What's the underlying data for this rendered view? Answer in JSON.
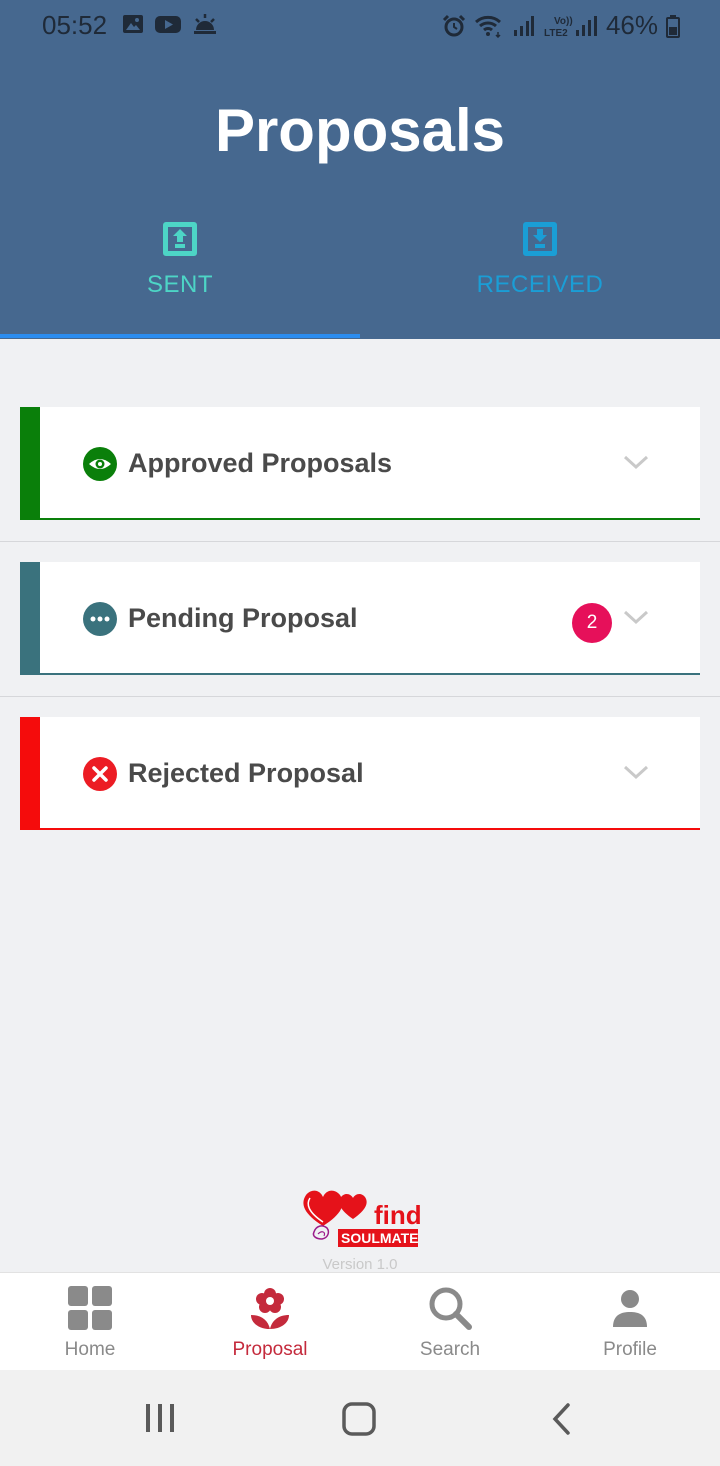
{
  "status_bar": {
    "time": "05:52",
    "battery": "46%",
    "left_icons": [
      "image-icon",
      "youtube-icon",
      "weather-icon"
    ],
    "right_icons": [
      "alarm-icon",
      "wifi-icon",
      "signal-icon",
      "volte-lte2-icon",
      "battery-icon"
    ]
  },
  "header": {
    "title": "Proposals",
    "tabs": [
      {
        "label": "SENT",
        "icon": "outbox-upload-icon",
        "color": "#4dd5c6",
        "selected": true
      },
      {
        "label": "RECEIVED",
        "icon": "inbox-download-icon",
        "color": "#1a9ed6",
        "selected": false
      }
    ],
    "background": "#46688f",
    "indicator_color": "#2b8df0"
  },
  "sections": [
    {
      "label": "Approved Proposals",
      "icon": "eye-icon",
      "accent": "#0a7f0a"
    },
    {
      "label": "Pending Proposal",
      "icon": "more-dots-icon",
      "accent": "#3a727d",
      "badge": "2"
    },
    {
      "label": "Rejected Proposal",
      "icon": "close-circle-icon",
      "accent": "#f50c0c"
    }
  ],
  "footer": {
    "logo_text": "find SOULMATE",
    "version": "Version 1.0"
  },
  "bottom_nav": {
    "items": [
      {
        "label": "Home",
        "icon": "grid-icon",
        "active": false
      },
      {
        "label": "Proposal",
        "icon": "flower-icon",
        "active": true
      },
      {
        "label": "Search",
        "icon": "search-icon",
        "active": false
      },
      {
        "label": "Profile",
        "icon": "person-icon",
        "active": false
      }
    ],
    "active_color": "#c42a3c",
    "inactive_color": "#8a8a8a"
  },
  "system_nav": [
    "recent-apps-icon",
    "home-icon",
    "back-icon"
  ]
}
